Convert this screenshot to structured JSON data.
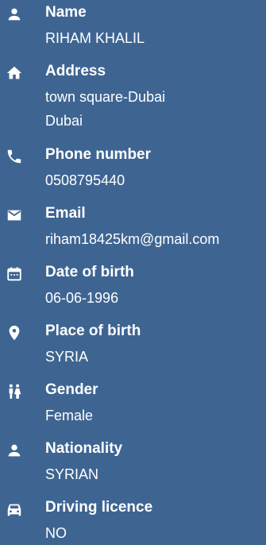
{
  "colors": {
    "background": "#3e6592",
    "text": "#ffffff"
  },
  "items": [
    {
      "icon": "person-icon",
      "label": "Name",
      "values": [
        "RIHAM KHALIL"
      ]
    },
    {
      "icon": "home-icon",
      "label": "Address",
      "values": [
        "town square-Dubai",
        "Dubai"
      ]
    },
    {
      "icon": "phone-icon",
      "label": "Phone number",
      "values": [
        "0508795440"
      ]
    },
    {
      "icon": "email-icon",
      "label": "Email",
      "values": [
        "riham18425km@gmail.com"
      ]
    },
    {
      "icon": "calendar-icon",
      "label": "Date of birth",
      "values": [
        "06-06-1996"
      ]
    },
    {
      "icon": "location-pin-icon",
      "label": "Place of birth",
      "values": [
        "SYRIA"
      ]
    },
    {
      "icon": "gender-icon",
      "label": "Gender",
      "values": [
        "Female"
      ]
    },
    {
      "icon": "person-icon",
      "label": "Nationality",
      "values": [
        "SYRIAN"
      ]
    },
    {
      "icon": "car-icon",
      "label": "Driving licence",
      "values": [
        "NO"
      ]
    }
  ]
}
